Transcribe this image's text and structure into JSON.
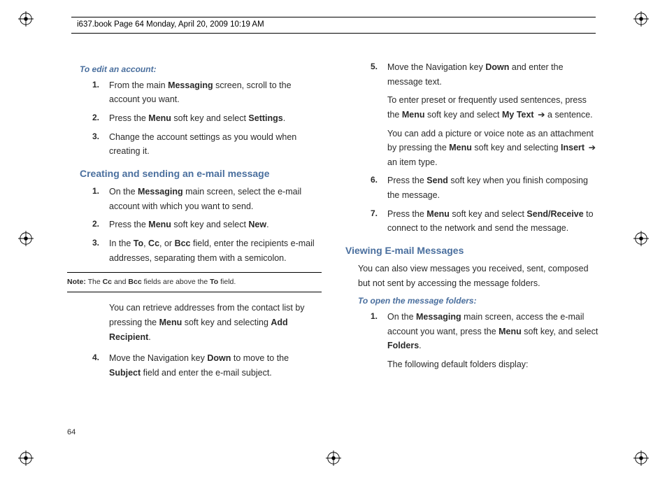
{
  "header": {
    "text": "i637.book  Page 64  Monday, April 20, 2009  10:19 AM"
  },
  "left": {
    "editHeading": "To edit an account:",
    "edit1_a": "From the main ",
    "edit1_b": "Messaging",
    "edit1_c": " screen, scroll to the account you want.",
    "edit2_a": "Press the ",
    "edit2_b": "Menu",
    "edit2_c": " soft key and select ",
    "edit2_d": "Settings",
    "edit2_e": ".",
    "edit3": "Change the account settings as you would when creating it.",
    "createHeading": "Creating and sending an e-mail message",
    "c1_a": "On the ",
    "c1_b": "Messaging",
    "c1_c": " main screen, select the e-mail account with which you want to send.",
    "c2_a": "Press the ",
    "c2_b": "Menu",
    "c2_c": " soft key and select ",
    "c2_d": "New",
    "c2_e": ".",
    "c3_a": "In the ",
    "c3_b": "To",
    "c3_c": ", ",
    "c3_d": "Cc",
    "c3_e": ", or ",
    "c3_f": "Bcc",
    "c3_g": " field, enter the recipients e-mail addresses, separating them with a semicolon.",
    "noteLabel": "Note:",
    "note_a": " The ",
    "note_b": "Cc",
    "note_c": " and ",
    "note_d": "Bcc",
    "note_e": " fields are above the ",
    "note_f": "To",
    "note_g": " field.",
    "retrieve_a": "You can retrieve addresses from the contact list by pressing the ",
    "retrieve_b": "Menu",
    "retrieve_c": " soft key and selecting ",
    "retrieve_d": "Add Recipient",
    "retrieve_e": ".",
    "c4_a": "Move the Navigation key ",
    "c4_b": "Down",
    "c4_c": " to move to the ",
    "c4_d": "Subject",
    "c4_e": " field and enter the e-mail subject."
  },
  "right": {
    "c5_a": "Move the Navigation key ",
    "c5_b": "Down",
    "c5_c": " and enter the message text.",
    "c5p2_a": "To enter preset or frequently used sentences, press the ",
    "c5p2_b": "Menu",
    "c5p2_c": " soft key and select ",
    "c5p2_d": "My Text",
    "c5p2_e": " ➔ a sentence.",
    "c5p3_a": "You can add a picture or voice note as an attachment by pressing the ",
    "c5p3_b": "Menu",
    "c5p3_c": " soft key and selecting ",
    "c5p3_d": "Insert",
    "c5p3_e": " ➔ an item type.",
    "c6_a": "Press the ",
    "c6_b": "Send",
    "c6_c": " soft key when you finish composing the message.",
    "c7_a": "Press the ",
    "c7_b": "Menu",
    "c7_c": " soft key and select ",
    "c7_d": "Send/Receive",
    "c7_e": " to connect to the network and send the message.",
    "viewHeading": "Viewing E-mail Messages",
    "viewBody": "You can also view messages you received, sent, composed but not sent by accessing the message folders.",
    "openHeading": "To open the message folders:",
    "o1_a": "On the ",
    "o1_b": "Messaging",
    "o1_c": " main screen, access the e-mail account you want, press the ",
    "o1_d": "Menu",
    "o1_e": " soft key, and select ",
    "o1_f": "Folders",
    "o1_g": ".",
    "o1p2": "The following default folders display:"
  },
  "pageNumber": "64",
  "nums": {
    "n1": "1.",
    "n2": "2.",
    "n3": "3.",
    "n4": "4.",
    "n5": "5.",
    "n6": "6.",
    "n7": "7."
  }
}
